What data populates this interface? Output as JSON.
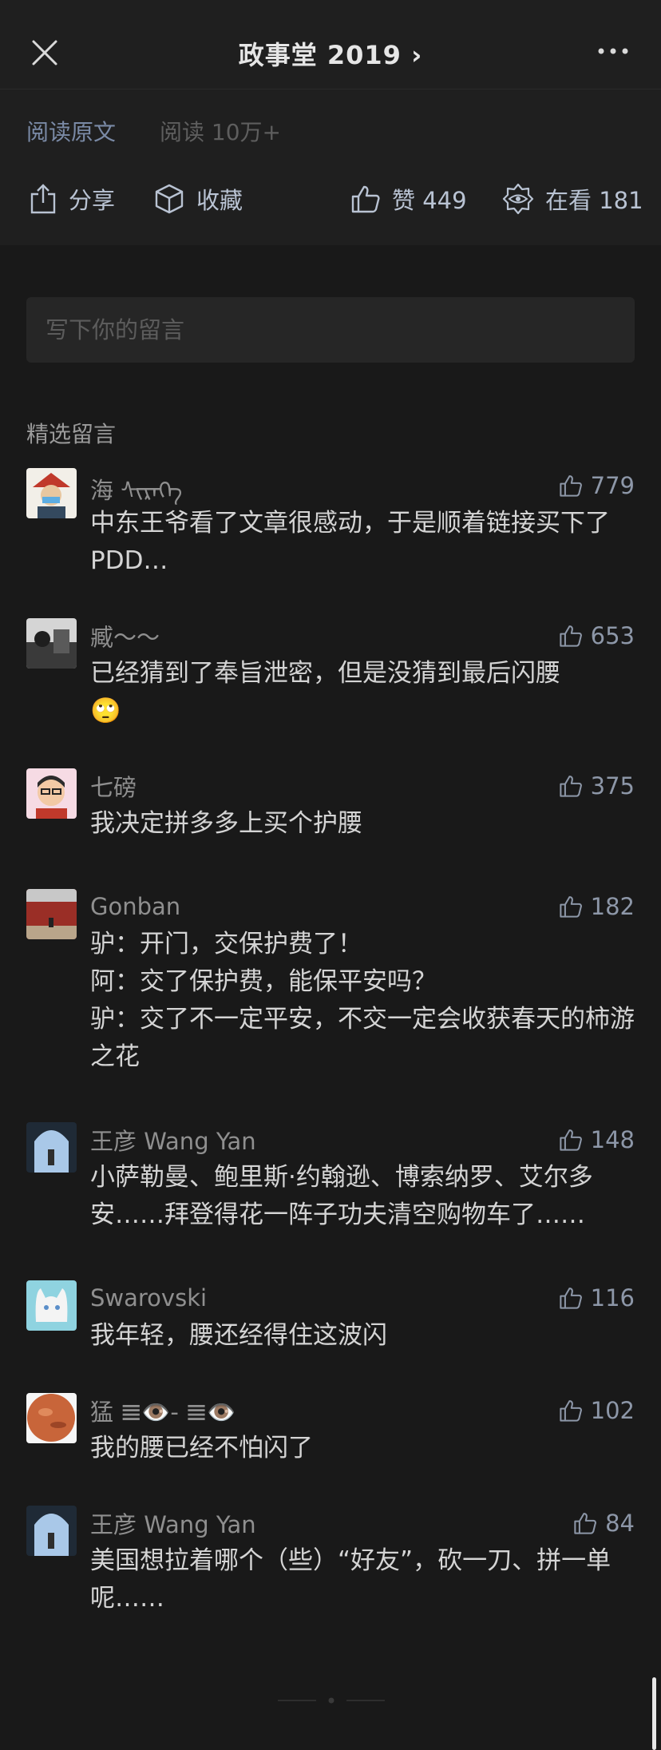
{
  "nav": {
    "title": "政事堂 2019 ›",
    "close_icon": "close-icon",
    "more_icon": "more-icon"
  },
  "read": {
    "original_link": "阅读原文",
    "read_count": "阅读 10万+"
  },
  "actions": {
    "share": "分享",
    "favorite": "收藏",
    "like": "赞 449",
    "watching": "在看 181"
  },
  "comment_input": {
    "placeholder": "写下你的留言"
  },
  "section": {
    "title": "精选留言"
  },
  "comments": [
    {
      "name": "海 ᠰᠢᠷᠡᠭᠡ",
      "likes": "779",
      "text": "中东王爷看了文章很感动，于是顺着链接买下了PDD…"
    },
    {
      "name": "臧～～",
      "likes": "653",
      "text": "已经猜到了奉旨泄密，但是没猜到最后闪腰\n🙄"
    },
    {
      "name": "七磅",
      "likes": "375",
      "text": "我决定拼多多上买个护腰"
    },
    {
      "name": "Gonban",
      "likes": "182",
      "text": "驴：开门，交保护费了！\n阿：交了保护费，能保平安吗？\n驴：交了不一定平安，不交一定会收获春天的柿游之花"
    },
    {
      "name": "王彦 Wang Yan",
      "likes": "148",
      "text": "小萨勒曼、鲍里斯·约翰逊、博索纳罗、艾尔多安……拜登得花一阵子功夫清空购物车了……"
    },
    {
      "name": "Swarovski",
      "likes": "116",
      "text": "我年轻，腰还经得住这波闪"
    },
    {
      "name": "猛 𝌆👁️- 𝌆👁️",
      "likes": "102",
      "text": "我的腰已经不怕闪了"
    },
    {
      "name": "王彦 Wang Yan",
      "likes": "84",
      "text": "美国想拉着哪个（些）“好友”，砍一刀、拼一单呢……"
    }
  ],
  "colors": {
    "background": "#191919",
    "header_bg": "#1f1f1f",
    "link": "#7a8aa6",
    "action": "#b9c3d3"
  }
}
